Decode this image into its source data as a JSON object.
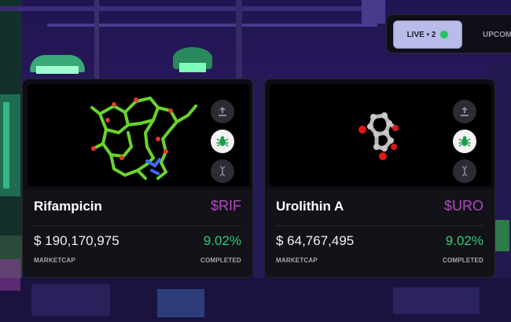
{
  "tabs": {
    "live_label": "LIVE • 2",
    "upcoming_label": "UPCOMI"
  },
  "colors": {
    "live_dot": "#22c55e",
    "ticker": "#b04bbd",
    "percent": "#2ecc71"
  },
  "cards": [
    {
      "name": "Rifampicin",
      "ticker": "$RIF",
      "marketcap": "$ 190,170,975",
      "marketcap_label": "MARKETCAP",
      "percent": "9.02%",
      "percent_label": "COMPLETED",
      "buttons": [
        "upload-icon",
        "bug-icon",
        "dna-icon"
      ]
    },
    {
      "name": "Urolithin A",
      "ticker": "$URO",
      "marketcap": "$ 64,767,495",
      "marketcap_label": "MARKETCAP",
      "percent": "9.02%",
      "percent_label": "COMPLETED",
      "buttons": [
        "upload-icon",
        "bug-icon",
        "dna-icon"
      ]
    }
  ]
}
